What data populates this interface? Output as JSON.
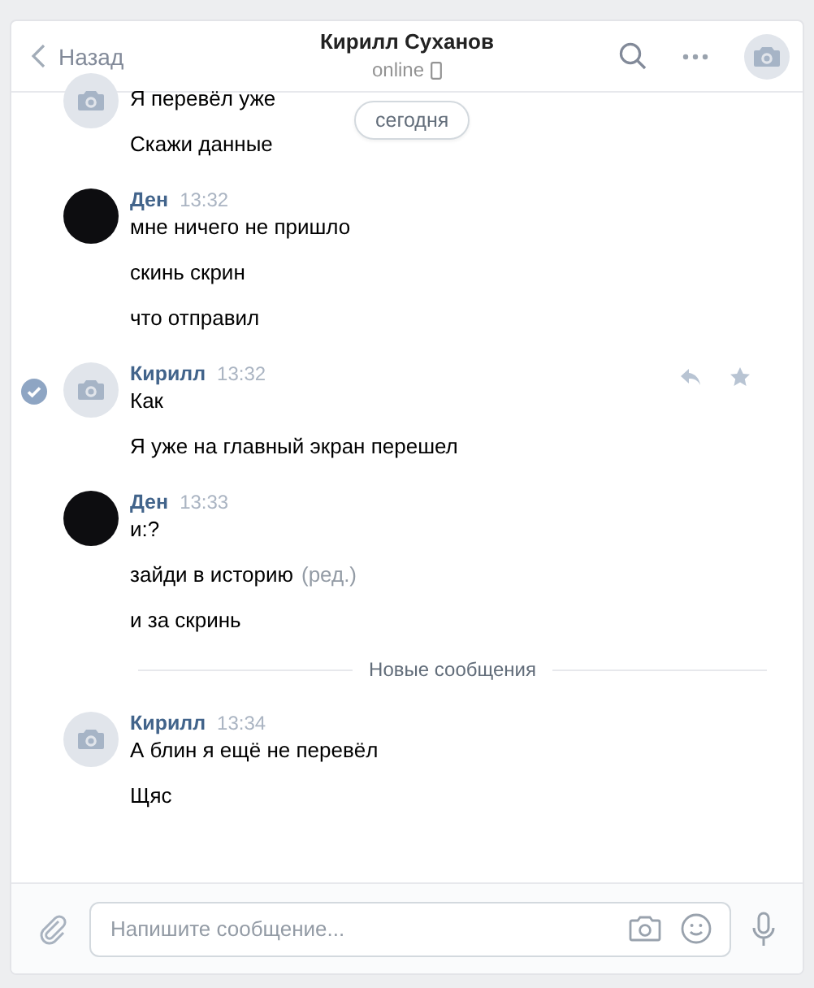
{
  "header": {
    "back_label": "Назад",
    "title": "Кирилл Суханов",
    "status": "online"
  },
  "date_pill": "сегодня",
  "groups": [
    {
      "kind": "camera",
      "selected": false,
      "messages": [
        {
          "text": "Я перевёл уже"
        },
        {
          "text": "Скажи данные"
        }
      ]
    },
    {
      "kind": "photo",
      "author": "Ден",
      "time": "13:32",
      "selected": false,
      "messages": [
        {
          "text": "мне ничего не пришло"
        },
        {
          "text": "скинь скрин"
        },
        {
          "text": "что отправил"
        }
      ]
    },
    {
      "kind": "camera",
      "author": "Кирилл",
      "time": "13:32",
      "selected": true,
      "messages": [
        {
          "text": "Как"
        },
        {
          "text": "Я уже на главный экран перешел"
        }
      ]
    },
    {
      "kind": "photo",
      "author": "Ден",
      "time": "13:33",
      "selected": false,
      "messages": [
        {
          "text": "и:?"
        },
        {
          "text": "зайди в историю",
          "edited": "(ред.)"
        },
        {
          "text": "и за скринь"
        }
      ]
    },
    {
      "kind": "divider",
      "label": "Новые сообщения"
    },
    {
      "kind": "camera",
      "author": "Кирилл",
      "time": "13:34",
      "selected": false,
      "messages": [
        {
          "text": "А блин я ещё не перевёл"
        },
        {
          "text": "Щяс"
        }
      ]
    }
  ],
  "composer": {
    "placeholder": "Напишите сообщение..."
  }
}
